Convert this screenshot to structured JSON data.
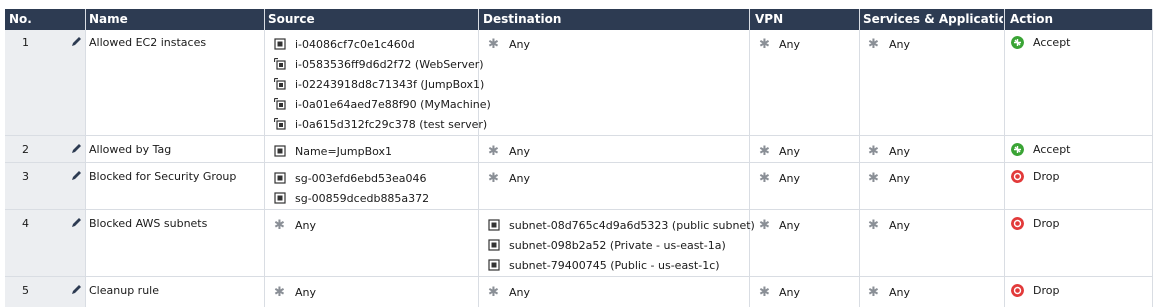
{
  "columns": {
    "no": "No.",
    "name": "Name",
    "source": "Source",
    "destination": "Destination",
    "vpn": "VPN",
    "services": "Services & Applications",
    "action": "Action"
  },
  "rows": [
    {
      "no": "1",
      "name": "Allowed EC2 instaces",
      "source": [
        {
          "text": "i-04086cf7c0e1c460d",
          "icon": "network-object-icon"
        },
        {
          "text": "i-0583536ff9d6d2f72 (WebServer)",
          "icon": "instance-icon"
        },
        {
          "text": "i-02243918d8c71343f (JumpBox1)",
          "icon": "instance-icon"
        },
        {
          "text": "i-0a01e64aed7e88f90 (MyMachine)",
          "icon": "instance-icon"
        },
        {
          "text": "i-0a615d312fc29c378 (test server)",
          "icon": "instance-icon"
        }
      ],
      "destination": [
        {
          "text": "Any",
          "icon": "any-icon"
        }
      ],
      "vpn": "Any",
      "services": "Any",
      "action": "Accept"
    },
    {
      "no": "2",
      "name": "Allowed by Tag",
      "source": [
        {
          "text": "Name=JumpBox1",
          "icon": "network-object-icon"
        }
      ],
      "destination": [
        {
          "text": "Any",
          "icon": "any-icon"
        }
      ],
      "vpn": "Any",
      "services": "Any",
      "action": "Accept"
    },
    {
      "no": "3",
      "name": "Blocked for Security Group",
      "source": [
        {
          "text": "sg-003efd6ebd53ea046",
          "icon": "network-object-icon"
        },
        {
          "text": "sg-00859dcedb885a372",
          "icon": "network-object-icon"
        }
      ],
      "destination": [
        {
          "text": "Any",
          "icon": "any-icon"
        }
      ],
      "vpn": "Any",
      "services": "Any",
      "action": "Drop"
    },
    {
      "no": "4",
      "name": "Blocked AWS subnets",
      "source": [
        {
          "text": "Any",
          "icon": "any-icon"
        }
      ],
      "destination": [
        {
          "text": "subnet-08d765c4d9a6d5323 (public subnet)",
          "icon": "network-object-icon"
        },
        {
          "text": "subnet-098b2a52 (Private - us-east-1a)",
          "icon": "network-object-icon"
        },
        {
          "text": "subnet-79400745 (Public - us-east-1c)",
          "icon": "network-object-icon"
        }
      ],
      "vpn": "Any",
      "services": "Any",
      "action": "Drop"
    },
    {
      "no": "5",
      "name": "Cleanup rule",
      "source": [
        {
          "text": "Any",
          "icon": "any-icon"
        }
      ],
      "destination": [
        {
          "text": "Any",
          "icon": "any-icon"
        }
      ],
      "vpn": "Any",
      "services": "Any",
      "action": "Drop"
    }
  ],
  "colors": {
    "header_bg": "#2d3b52",
    "accept": "#3aa435",
    "drop": "#e23a3a",
    "any_star": "#8a8f96"
  }
}
